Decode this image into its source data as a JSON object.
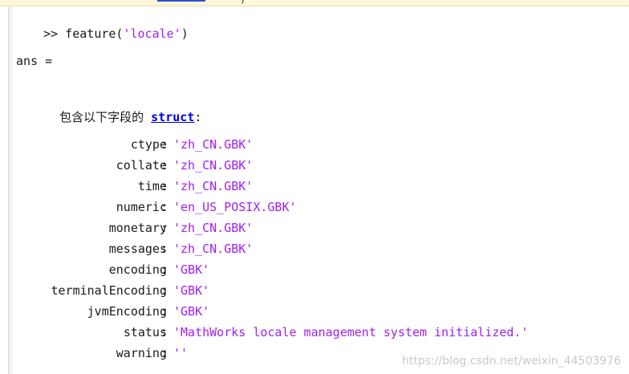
{
  "top_fragment": {
    "char": ")"
  },
  "command": {
    "prompt": ">>",
    "function": "feature(",
    "argument": "'locale'",
    "close": ")"
  },
  "ans_label": "ans =",
  "struct_intro": {
    "text": "包含以下字段的",
    "link": "struct",
    "colon": ":"
  },
  "fields": [
    {
      "name": "ctype",
      "value": "'zh_CN.GBK'"
    },
    {
      "name": "collate",
      "value": "'zh_CN.GBK'"
    },
    {
      "name": "time",
      "value": "'zh_CN.GBK'"
    },
    {
      "name": "numeric",
      "value": "'en_US_POSIX.GBK'"
    },
    {
      "name": "monetary",
      "value": "'zh_CN.GBK'"
    },
    {
      "name": "messages",
      "value": "'zh_CN.GBK'"
    },
    {
      "name": "encoding",
      "value": "'GBK'"
    },
    {
      "name": "terminalEncoding",
      "value": "'GBK'"
    },
    {
      "name": "jvmEncoding",
      "value": "'GBK'"
    },
    {
      "name": "status",
      "value": "'MathWorks locale management system initialized.'"
    },
    {
      "name": "warning",
      "value": "''"
    }
  ],
  "watermark": "https://blog.csdn.net/weixin_44503976",
  "colors": {
    "string": "#a020f0",
    "link": "#0000ee",
    "top_strip": "#fff8d8"
  }
}
